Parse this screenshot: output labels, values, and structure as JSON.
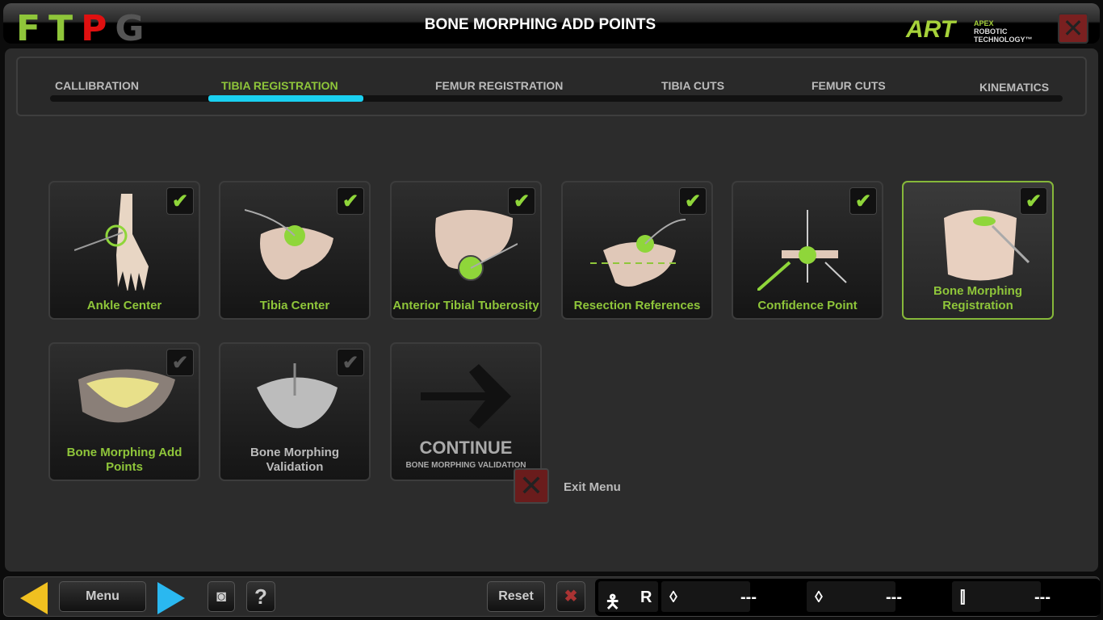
{
  "header": {
    "logo_letters": [
      {
        "char": "F",
        "color": "#8fc63a"
      },
      {
        "char": "T",
        "color": "#8fc63a"
      },
      {
        "char": "P",
        "color": "#e01010"
      },
      {
        "char": "G",
        "color": "#555555"
      }
    ],
    "title": "BONE MORPHING ADD POINTS",
    "brand": {
      "main": "ART",
      "sub1": "APEX",
      "sub2": "ROBOTIC",
      "sub3": "TECHNOLOGY™"
    },
    "close_icon": "close-x-icon"
  },
  "tabs": [
    {
      "label": "CALLIBRATION",
      "active": false
    },
    {
      "label": "TIBIA REGISTRATION",
      "active": true
    },
    {
      "label": "FEMUR REGISTRATION",
      "active": false
    },
    {
      "label": "TIBIA CUTS",
      "active": false
    },
    {
      "label": "FEMUR CUTS",
      "active": false
    },
    {
      "label": "KINEMATICS",
      "active": false
    }
  ],
  "cards": [
    {
      "label": "Ankle Center",
      "checked": true
    },
    {
      "label": "Tibia Center",
      "checked": true
    },
    {
      "label": "Anterior Tibial Tuberosity",
      "checked": true
    },
    {
      "label": "Resection References",
      "checked": true
    },
    {
      "label": "Confidence Point",
      "checked": true
    },
    {
      "label": "Bone Morphing Registration",
      "checked": true,
      "selected": true
    },
    {
      "label": "Bone Morphing Add Points",
      "checked": false
    },
    {
      "label": "Bone Morphing Validation",
      "checked": false
    }
  ],
  "continue": {
    "label": "CONTINUE",
    "sub": "BONE MORPHING VALIDATION"
  },
  "exit": {
    "label": "Exit Menu"
  },
  "bottom": {
    "menu": "Menu",
    "reset": "Reset",
    "side": "R",
    "values": [
      "---",
      "---",
      "---"
    ]
  },
  "colors": {
    "accent": "#8fc63a",
    "progress": "#1ad0f0"
  }
}
